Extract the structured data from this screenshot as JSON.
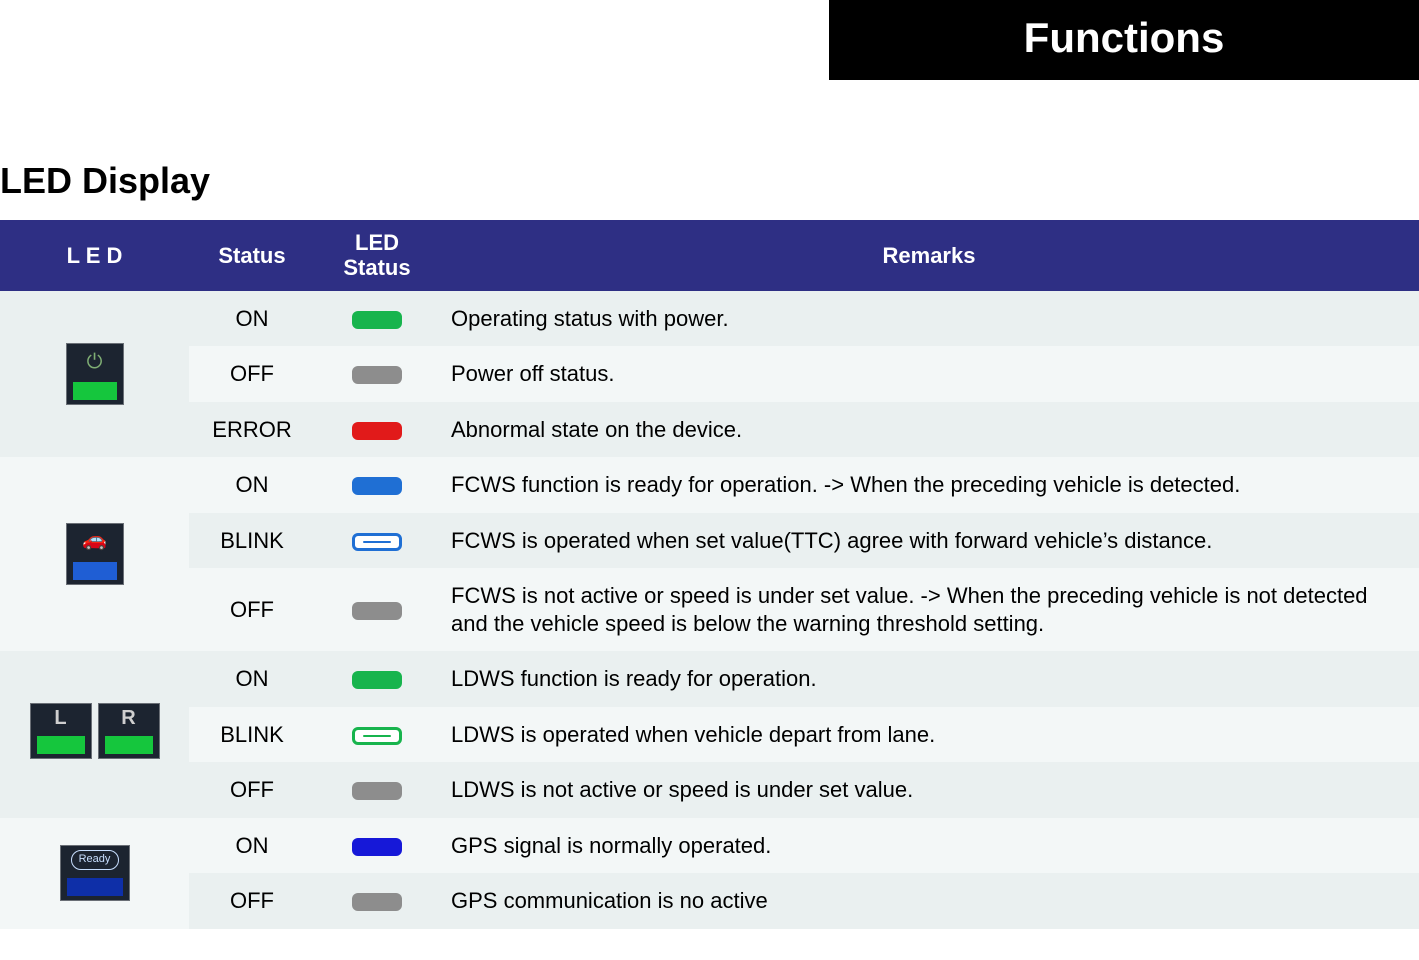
{
  "header": {
    "title": "Functions"
  },
  "section": {
    "title": "LED Display"
  },
  "columns": {
    "led": "L E D",
    "status": "Status",
    "led_status": "LED\nStatus",
    "remarks": "Remarks"
  },
  "groups": [
    {
      "led_icon": "power",
      "rows": [
        {
          "status": "ON",
          "pill": "green",
          "remarks": "Operating status with power."
        },
        {
          "status": "OFF",
          "pill": "gray",
          "remarks": "Power off status."
        },
        {
          "status": "ERROR",
          "pill": "red",
          "remarks": "Abnormal state on the device."
        }
      ]
    },
    {
      "led_icon": "car",
      "rows": [
        {
          "status": "ON",
          "pill": "blue",
          "remarks": "FCWS function is ready for operation. -> When the preceding vehicle is detected."
        },
        {
          "status": "BLINK",
          "pill": "outline-blue",
          "remarks": "FCWS is operated when set value(TTC) agree with forward vehicle’s distance."
        },
        {
          "status": "OFF",
          "pill": "gray",
          "remarks": "FCWS is not active or speed is under set value. -> When the preceding vehicle is not detected and the vehicle speed is below the warning threshold setting."
        }
      ]
    },
    {
      "led_icon": "lr",
      "rows": [
        {
          "status": "ON",
          "pill": "green",
          "remarks": "LDWS function is ready for operation."
        },
        {
          "status": "BLINK",
          "pill": "outline-green",
          "remarks": "LDWS is operated when vehicle depart from lane."
        },
        {
          "status": "OFF",
          "pill": "gray",
          "remarks": "LDWS is not active or speed is under set value."
        }
      ]
    },
    {
      "led_icon": "ready",
      "rows": [
        {
          "status": "ON",
          "pill": "dblue",
          "remarks": "GPS signal is normally operated."
        },
        {
          "status": "OFF",
          "pill": "gray",
          "remarks": "GPS communication is no active"
        }
      ]
    }
  ],
  "icon_labels": {
    "ready_badge": "Ready",
    "L": "L",
    "R": "R"
  }
}
